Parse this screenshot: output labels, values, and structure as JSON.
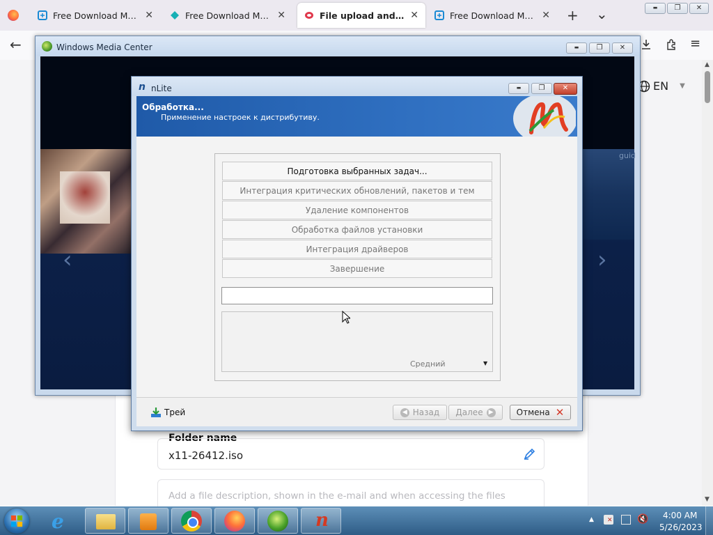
{
  "browser": {
    "tabs": [
      {
        "title": "Free Download Manager",
        "active": false
      },
      {
        "title": "Free Download Manager",
        "active": false
      },
      {
        "title": "File upload and sharing.",
        "active": true
      },
      {
        "title": "Free Download Manager",
        "active": false
      }
    ],
    "new_tab": "+",
    "tab_list": "⌄",
    "window_controls": {
      "minimize": "▬",
      "restore": "❐",
      "close": "✕"
    }
  },
  "page": {
    "language": "EN",
    "folder_name_label": "Folder name",
    "folder_name_value": "x11-26412.iso",
    "description_placeholder": "Add a file description, shown in the e-mail and when accessing the files"
  },
  "wmc": {
    "title": "Windows Media Center",
    "prev": "‹",
    "next": "›",
    "guide": "guid"
  },
  "nlite": {
    "title": "nLite",
    "header_title": "Обработка...",
    "header_subtitle": "Применение настроек к дистрибутиву.",
    "tasks": [
      {
        "label": "Подготовка выбранных задач...",
        "current": true
      },
      {
        "label": "Интеграция критических обновлений, пакетов и тем",
        "current": false
      },
      {
        "label": "Удаление компонентов",
        "current": false
      },
      {
        "label": "Обработка файлов установки",
        "current": false
      },
      {
        "label": "Интеграция драйверов",
        "current": false
      },
      {
        "label": "Завершение",
        "current": false
      }
    ],
    "priority_value": "Средний",
    "tray_label": "Трей",
    "back_label": "Назад",
    "next_label": "Далее",
    "cancel_label": "Отмена"
  },
  "taskbar": {
    "time": "4:00 AM",
    "date": "5/26/2023"
  }
}
